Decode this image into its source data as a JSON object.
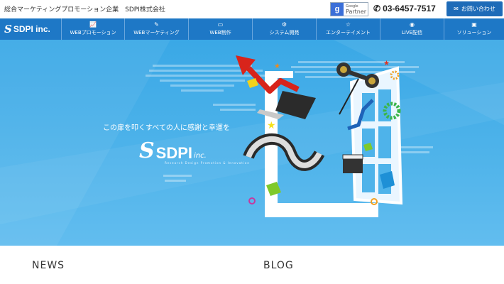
{
  "header": {
    "tagline": "総合マーケティングプロモーション企業　SDPI株式会社",
    "partner_label": "Google Partner",
    "partner_small": "Google",
    "partner_big": "Partner",
    "phone": "03-6457-7517",
    "contact_label": "お問い合わせ"
  },
  "nav": {
    "logo_text": "SDPI inc.",
    "items": [
      {
        "label": "WEBプロモーション",
        "icon": "chart-icon"
      },
      {
        "label": "WEBマーケティング",
        "icon": "pencil-icon"
      },
      {
        "label": "WEB制作",
        "icon": "monitor-icon"
      },
      {
        "label": "システム開発",
        "icon": "gears-icon"
      },
      {
        "label": "エンターテイメント",
        "icon": "star-icon"
      },
      {
        "label": "LIVE配信",
        "icon": "camera-icon"
      },
      {
        "label": "ソリューション",
        "icon": "briefcase-icon"
      }
    ]
  },
  "hero": {
    "slogan": "この扉を叩くすべての人に感謝と幸運を",
    "logo_text": "SDPI",
    "logo_suffix": "inc.",
    "logo_subline": "Research Design Promotion & Innovation"
  },
  "sections": {
    "news_title": "NEWS",
    "blog_title": "BLOG"
  },
  "colors": {
    "nav_bg": "#1e78c6",
    "hero_bg": "#4eb3ea",
    "contact_bg": "#1e6bb8"
  }
}
